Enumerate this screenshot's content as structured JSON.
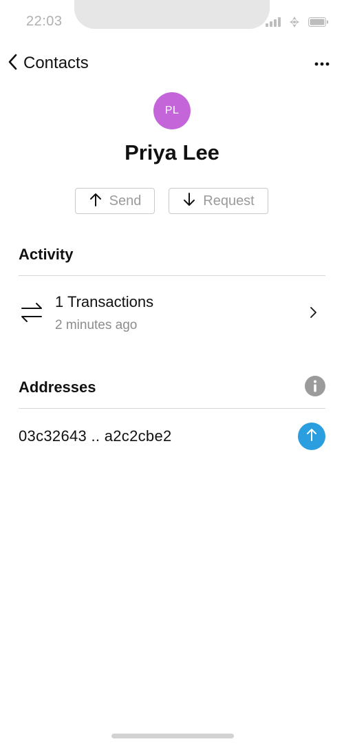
{
  "status_bar": {
    "time": "22:03",
    "icons": [
      "signal-icon",
      "wifi-icon",
      "battery-icon"
    ]
  },
  "header": {
    "back_label": "Contacts",
    "icons": [
      "chevron-left-icon",
      "more-horizontal-icon"
    ]
  },
  "contact": {
    "initials": "PL",
    "name": "Priya Lee",
    "avatar_color": "#c466d9"
  },
  "actions": {
    "send_label": "Send",
    "request_label": "Request"
  },
  "activity": {
    "title": "Activity",
    "primary": "1 Transactions",
    "secondary": "2 minutes ago"
  },
  "addresses": {
    "title": "Addresses",
    "items": [
      {
        "address": "03c32643 .. a2c2cbe2"
      }
    ]
  },
  "colors": {
    "accent": "#2b9ee0",
    "muted": "#8c8c8c",
    "info_icon": "#9b9b9b"
  }
}
